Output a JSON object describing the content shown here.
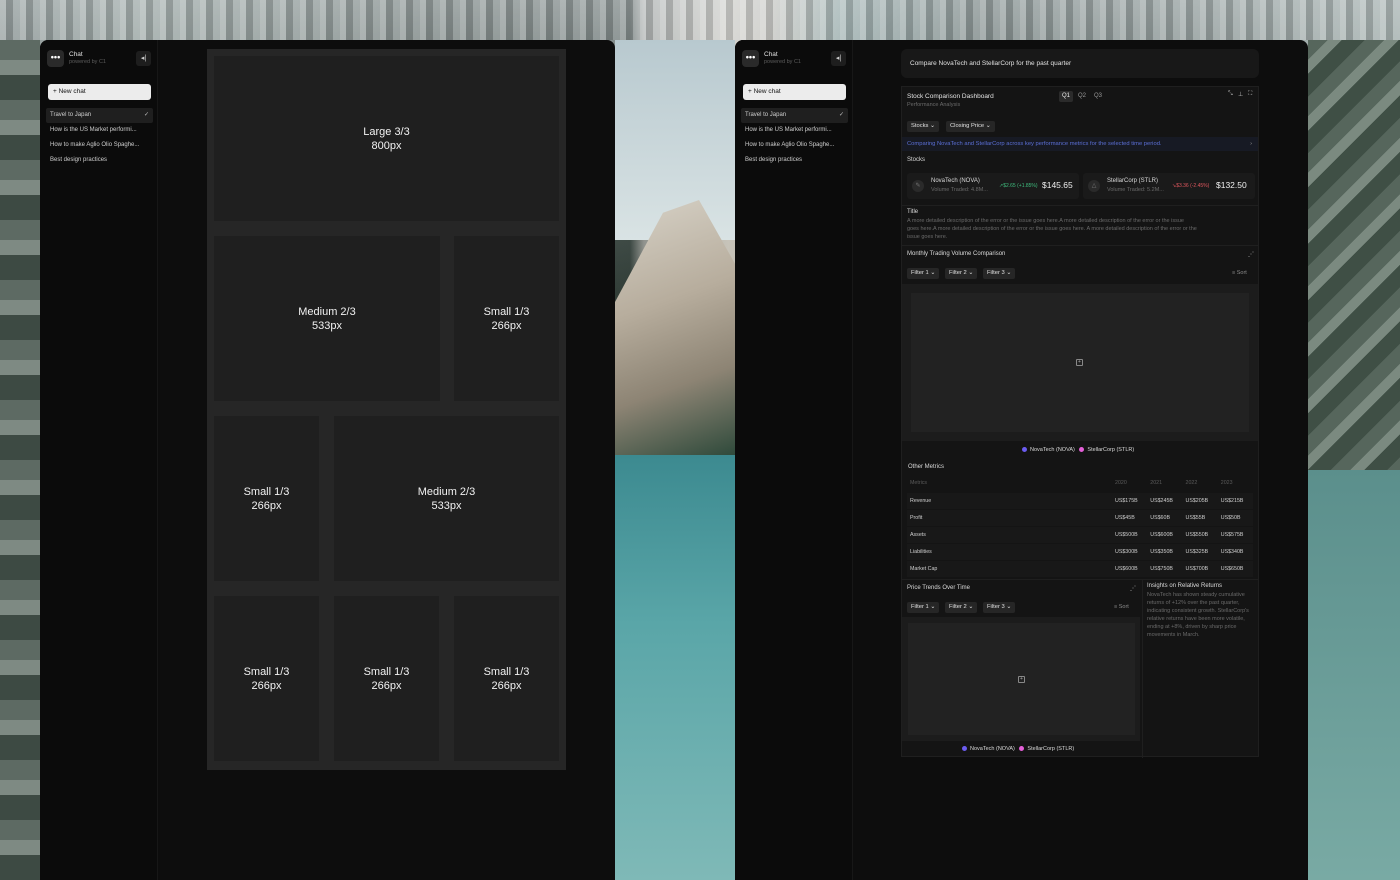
{
  "sidebar": {
    "app_title": "Chat",
    "app_subtitle": "powered by C1",
    "logo_glyph": "•••",
    "collapse_glyph": "◂|",
    "new_chat_label": "New chat",
    "items": [
      {
        "label": "Travel to Japan",
        "active": true
      },
      {
        "label": "How is the US Market performi..."
      },
      {
        "label": "How to make Aglio Olio Spaghe..."
      },
      {
        "label": "Best design practices"
      }
    ]
  },
  "grid": {
    "tiles": [
      {
        "title": "Large 3/3",
        "size": "800px"
      },
      {
        "title": "Medium 2/3",
        "size": "533px"
      },
      {
        "title": "Small 1/3",
        "size": "266px"
      },
      {
        "title": "Small 1/3",
        "size": "266px"
      },
      {
        "title": "Medium 2/3",
        "size": "533px"
      },
      {
        "title": "Small 1/3",
        "size": "266px"
      },
      {
        "title": "Small 1/3",
        "size": "266px"
      },
      {
        "title": "Small 1/3",
        "size": "266px"
      }
    ]
  },
  "dashboard": {
    "prompt": "Compare NovaTech and StellarCorp for the past quarter",
    "title": "Stock Comparison Dashboard",
    "subtitle": "Performance Analysis",
    "quarter_tabs": [
      "Q1",
      "Q2",
      "Q3"
    ],
    "active_quarter": "Q1",
    "filters": [
      "Stocks",
      "Closing Price"
    ],
    "banner": "Comparing NovaTech and StellarCorp across key performance metrics for the selected time period.",
    "stocks_heading": "Stocks",
    "stocks": [
      {
        "name": "NovaTech (NOVA)",
        "volume": "Volume Traded: 4.8M...",
        "change": "$2.65 (+1.85%)",
        "price": "$145.65",
        "color": "#3fbf7f"
      },
      {
        "name": "StellarCorp (STLR)",
        "volume": "Volume Traded: 5.2M...",
        "change": "$3.36 (-2.45%)",
        "price": "$132.50",
        "color": "#e0575e"
      }
    ],
    "notice_title": "Title",
    "notice_body": "A more detailed description of the error or the issue goes here.A more detailed description of the error or the issue goes here.A more detailed description of the error or the issue goes here. A more detailed description of the error or the issue goes here.",
    "volume_chart_title": "Monthly Trading Volume Comparison",
    "chart_filters": [
      "Filter 1",
      "Filter 2",
      "Filter 3"
    ],
    "sort_label": "Sort",
    "legend": [
      {
        "name": "NovaTech (NOVA)",
        "color": "#6b5cf0"
      },
      {
        "name": "StellarCorp (STLR)",
        "color": "#e45fd8"
      }
    ],
    "metrics_title": "Other Metrics",
    "metrics_header": [
      "Metrics",
      "2020",
      "2021",
      "2022",
      "2023"
    ],
    "metrics_rows": [
      [
        "Revenue",
        "US$175B",
        "US$245B",
        "US$205B",
        "US$215B"
      ],
      [
        "Profit",
        "US$45B",
        "US$60B",
        "US$55B",
        "US$50B"
      ],
      [
        "Assets",
        "US$500B",
        "US$600B",
        "US$550B",
        "US$575B"
      ],
      [
        "Liabilities",
        "US$300B",
        "US$350B",
        "US$325B",
        "US$340B"
      ],
      [
        "Market Cap",
        "US$600B",
        "US$750B",
        "US$700B",
        "US$650B"
      ]
    ],
    "price_chart_title": "Price Trends Over Time",
    "insights_title": "Insights on Relative Returns",
    "insights_body": "NovaTech has shown steady cumulative returns of +12% over the past quarter, indicating consistent growth. StellarCorp's relative returns have been more volatile, ending at +8%, driven by sharp price movements in March."
  }
}
